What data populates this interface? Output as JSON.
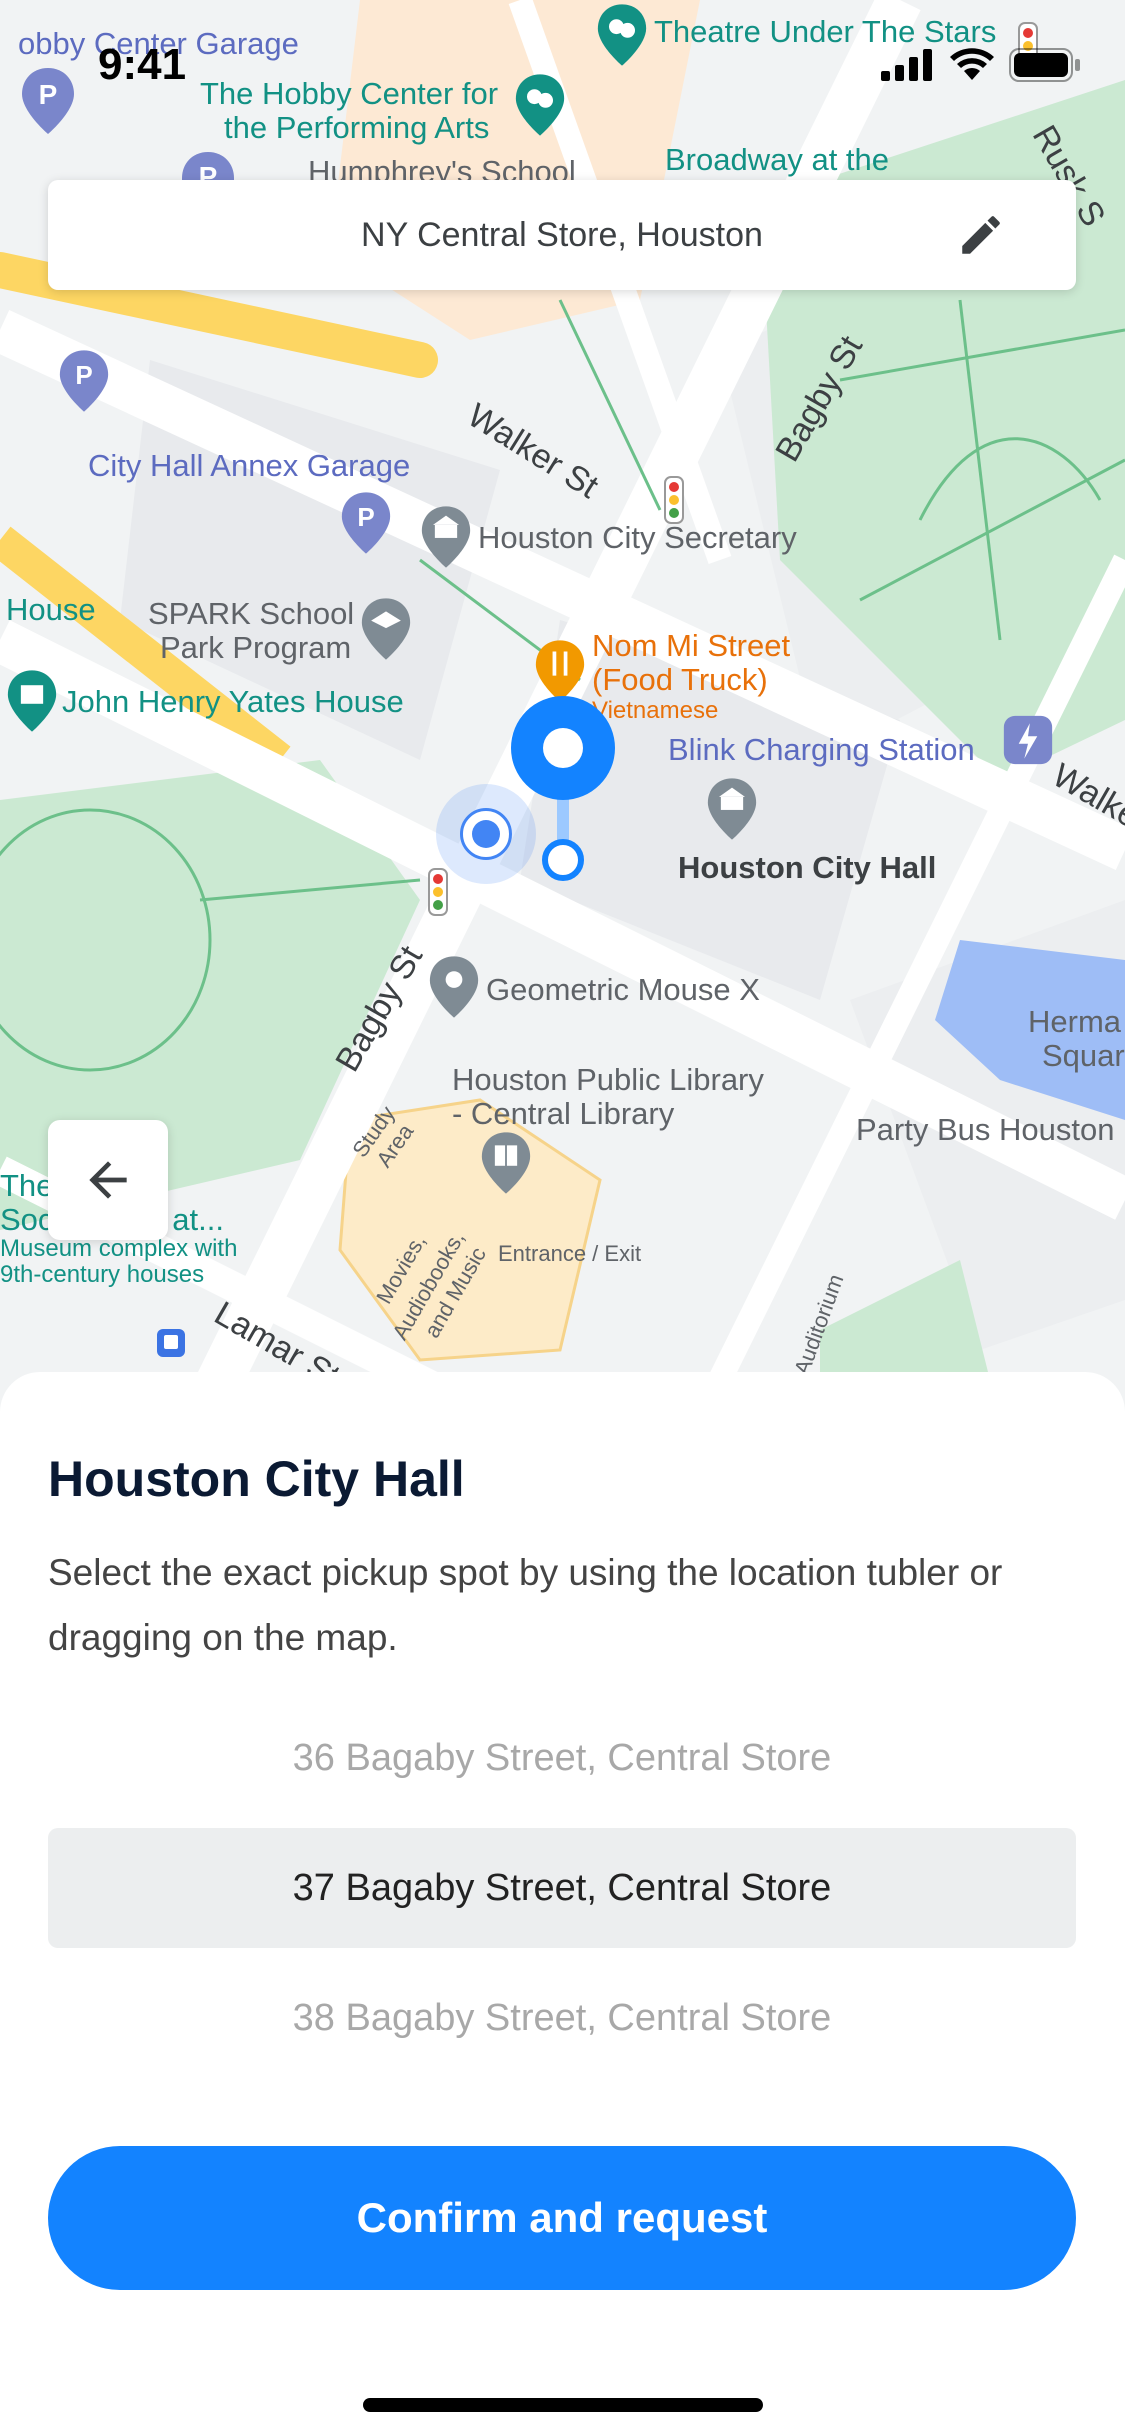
{
  "status_bar": {
    "time": "9:41",
    "icons": [
      "signal-icon",
      "wifi-icon",
      "battery-icon"
    ]
  },
  "search": {
    "value": "NY Central Store, Houston",
    "edit_icon": "pencil-icon"
  },
  "map": {
    "labels": {
      "hobby_garage": "obby Center Garage",
      "theatre": "Theatre Under The Stars",
      "hobby_center_1": "The Hobby Center for",
      "hobby_center_2": "the Performing Arts",
      "humphrey": "Humphrey's School",
      "broadway": "Broadway at the",
      "rusk": "Rusk S",
      "walker": "Walker St",
      "bagby_top": "Bagby St",
      "annex_garage": "City Hall Annex Garage",
      "secretary": "Houston City Secretary",
      "house": "House",
      "spark_1": "SPARK School",
      "spark_2": "Park Program",
      "nom_mi_1": "Nom Mi Street",
      "nom_mi_2": "(Food Truck)",
      "nom_mi_3": "Vietnamese",
      "yates": "John Henry Yates House",
      "blink": "Blink Charging Station",
      "walke": "Walke",
      "city_hall": "Houston City Hall",
      "bagby_bottom": "Bagby St",
      "geometric": "Geometric Mouse X",
      "herman_1": "Herma",
      "herman_2": "Squar",
      "library_1": "Houston Public Library",
      "library_2": "- Central Library",
      "party_bus": "Party Bus Houston",
      "study_1": "Study",
      "study_2": "Area",
      "museum_1": "The",
      "museum_2": "Soci     eum at...",
      "museum_3": "Museum complex with",
      "museum_4": "9th-century houses",
      "movies_1": "Movies,",
      "movies_2": "Audiobooks,",
      "movies_3": "and Music",
      "entrance": "Entrance / Exit",
      "auditorium": "Auditorium",
      "lamar": "Lamar St"
    },
    "back_icon": "arrow-left-icon"
  },
  "sheet": {
    "title": "Houston City Hall",
    "description": "Select the exact pickup spot by using the location tubler or dragging on the map.",
    "addresses": [
      "36 Bagaby Street, Central Store",
      "37 Bagaby Street, Central Store",
      "38 Bagaby Street, Central Store"
    ],
    "selected_index": 1,
    "confirm_label": "Confirm and request"
  },
  "colors": {
    "accent": "#1383ff",
    "park": "#cbe9d2",
    "road": "#ffffff",
    "highway": "#fdd663"
  }
}
